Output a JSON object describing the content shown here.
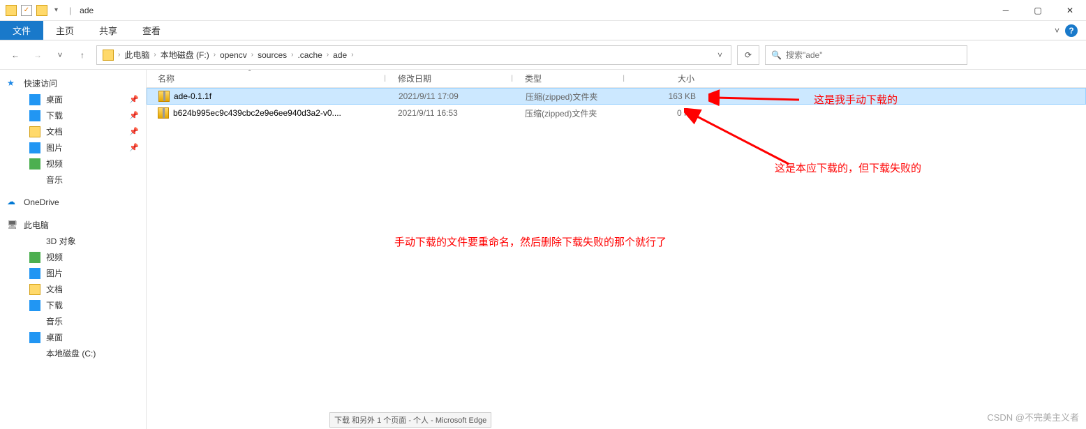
{
  "titlebar": {
    "folder_name": "ade",
    "sep": "|"
  },
  "ribbon": {
    "file": "文件",
    "home": "主页",
    "share": "共享",
    "view": "查看"
  },
  "nav": {
    "back": "←",
    "fwd": "→",
    "up": "↑",
    "drop": "˅"
  },
  "breadcrumb": [
    "此电脑",
    "本地磁盘 (F:)",
    "opencv",
    "sources",
    ".cache",
    "ade"
  ],
  "search": {
    "placeholder": "搜索\"ade\""
  },
  "sidebar": {
    "quick": "快速访问",
    "quick_items": [
      {
        "label": "桌面",
        "icon": "icon-blue",
        "pin": true
      },
      {
        "label": "下载",
        "icon": "icon-blue",
        "pin": true
      },
      {
        "label": "文档",
        "icon": "icon-yellow",
        "pin": true
      },
      {
        "label": "图片",
        "icon": "icon-blue",
        "pin": true
      },
      {
        "label": "视频",
        "icon": "icon-green",
        "pin": false
      },
      {
        "label": "音乐",
        "icon": "icon-music",
        "pin": false
      }
    ],
    "onedrive": "OneDrive",
    "thispc": "此电脑",
    "pc_items": [
      {
        "label": "3D 对象",
        "icon": "icon-3d"
      },
      {
        "label": "视频",
        "icon": "icon-green"
      },
      {
        "label": "图片",
        "icon": "icon-blue"
      },
      {
        "label": "文档",
        "icon": "icon-yellow"
      },
      {
        "label": "下载",
        "icon": "icon-blue"
      },
      {
        "label": "音乐",
        "icon": "icon-music"
      },
      {
        "label": "桌面",
        "icon": "icon-blue"
      },
      {
        "label": "本地磁盘 (C:)",
        "icon": "icon-pc"
      }
    ]
  },
  "columns": {
    "name": "名称",
    "date": "修改日期",
    "type": "类型",
    "size": "大小"
  },
  "files": [
    {
      "name": "ade-0.1.1f",
      "date": "2021/9/11 17:09",
      "type": "压缩(zipped)文件夹",
      "size": "163 KB",
      "selected": true
    },
    {
      "name": "b624b995ec9c439cbc2e9e6ee940d3a2-v0....",
      "date": "2021/9/11 16:53",
      "type": "压缩(zipped)文件夹",
      "size": "0 KB",
      "selected": false
    }
  ],
  "annotations": {
    "a1": "这是我手动下载的",
    "a2": "这是本应下载的，但下载失败的",
    "a3": "手动下载的文件要重命名，然后删除下载失败的那个就行了"
  },
  "tooltip": "下载 和另外 1 个页面 - 个人 - Microsoft Edge",
  "watermark": "CSDN @不完美主义者"
}
